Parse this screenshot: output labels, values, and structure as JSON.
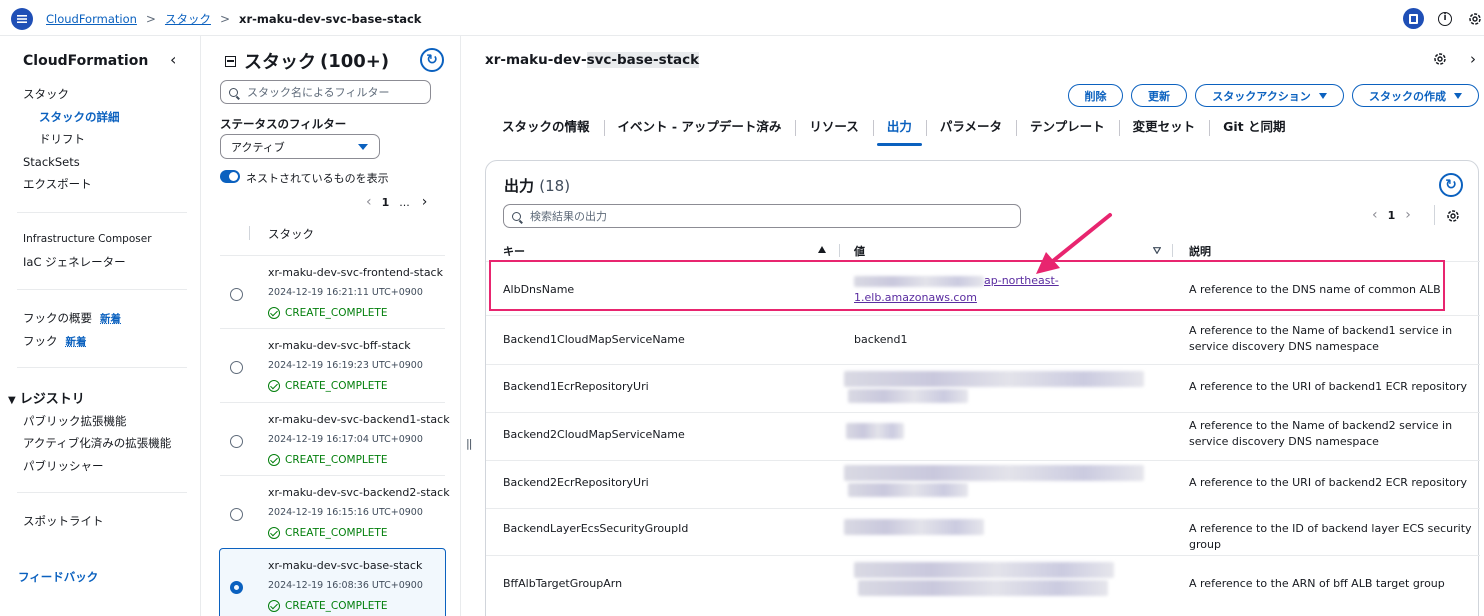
{
  "breadcrumb": {
    "root": "CloudFormation",
    "section": "スタック",
    "current": "xr-maku-dev-svc-base-stack"
  },
  "leftnav": {
    "title": "CloudFormation",
    "items": [
      {
        "label": "スタック"
      },
      {
        "label": "スタックの詳細"
      },
      {
        "label": "ドリフト"
      },
      {
        "label": "StackSets"
      },
      {
        "label": "エクスポート"
      },
      {
        "label": "Infrastructure Composer"
      },
      {
        "label": "IaC ジェネレーター"
      },
      {
        "label": "フックの概要"
      },
      {
        "label": "フック"
      }
    ],
    "new_badge": "新着",
    "registry_title": "レジストリ",
    "registry_items": [
      {
        "label": "パブリック拡張機能"
      },
      {
        "label": "アクティブ化済みの拡張機能"
      },
      {
        "label": "パブリッシャー"
      }
    ],
    "spotlight": "スポットライト",
    "feedback": "フィードバック"
  },
  "stacklist": {
    "title": "スタック",
    "count": "(100+)",
    "search_placeholder": "スタック名によるフィルター",
    "filter_label": "ステータスのフィルター",
    "filter_value": "アクティブ",
    "nested_label": "ネストされているものを表示",
    "page": "1",
    "ellipsis": "...",
    "column": "スタック",
    "stacks": [
      {
        "name": "xr-maku-dev-svc-frontend-stack",
        "time": "2024-12-19 16:21:11 UTC+0900",
        "status": "CREATE_COMPLETE",
        "selected": false
      },
      {
        "name": "xr-maku-dev-svc-bff-stack",
        "time": "2024-12-19 16:19:23 UTC+0900",
        "status": "CREATE_COMPLETE",
        "selected": false
      },
      {
        "name": "xr-maku-dev-svc-backend1-stack",
        "time": "2024-12-19 16:17:04 UTC+0900",
        "status": "CREATE_COMPLETE",
        "selected": false
      },
      {
        "name": "xr-maku-dev-svc-backend2-stack",
        "time": "2024-12-19 16:15:16 UTC+0900",
        "status": "CREATE_COMPLETE",
        "selected": false
      },
      {
        "name": "xr-maku-dev-svc-base-stack",
        "time": "2024-12-19 16:08:36 UTC+0900",
        "status": "CREATE_COMPLETE",
        "selected": true
      }
    ]
  },
  "main": {
    "title_plain": "xr-maku-dev-",
    "title_highlight": "svc-base-stack",
    "actions": {
      "delete": "削除",
      "update": "更新",
      "stack_actions": "スタックアクション",
      "create_stack": "スタックの作成"
    },
    "tabs": [
      {
        "label": "スタックの情報"
      },
      {
        "label": "イベント - アップデート済み"
      },
      {
        "label": "リソース"
      },
      {
        "label": "出力"
      },
      {
        "label": "パラメータ"
      },
      {
        "label": "テンプレート"
      },
      {
        "label": "変更セット"
      },
      {
        "label": "Git と同期"
      }
    ],
    "active_tab": "出力",
    "outputs": {
      "title": "出力",
      "count": "(18)",
      "search_placeholder": "検索結果の出力",
      "page": "1",
      "columns": {
        "key": "キー",
        "value": "値",
        "description": "説明"
      },
      "rows": [
        {
          "key": "AlbDnsName",
          "value_line1": "ap-northeast-",
          "value_line2": "1.elb.amazonaws.com",
          "description": "A reference to the DNS name of common ALB"
        },
        {
          "key": "Backend1CloudMapServiceName",
          "value": "backend1",
          "description": "A reference to the Name of backend1 service in service discovery DNS namespace"
        },
        {
          "key": "Backend1EcrRepositoryUri",
          "value": "",
          "description": "A reference to the URI of backend1 ECR repository"
        },
        {
          "key": "Backend2CloudMapServiceName",
          "value": "",
          "description": "A reference to the Name of backend2 service in service discovery DNS namespace"
        },
        {
          "key": "Backend2EcrRepositoryUri",
          "value": "",
          "description": "A reference to the URI of backend2 ECR repository"
        },
        {
          "key": "BackendLayerEcsSecurityGroupId",
          "value": "",
          "description": "A reference to the ID of backend layer ECS security group"
        },
        {
          "key": "BffAlbTargetGroupArn",
          "value": "",
          "description": "A reference to the ARN of bff ALB target group"
        }
      ]
    }
  },
  "colors": {
    "accent": "#0b61bf",
    "success": "#037f0c",
    "annotation": "#e8256f"
  },
  "icons": [
    "menu-icon",
    "chevron-right-icon",
    "panel-icon",
    "info-icon",
    "settings-icon",
    "refresh-icon",
    "search-icon",
    "gear-icon",
    "check-circle-icon"
  ]
}
